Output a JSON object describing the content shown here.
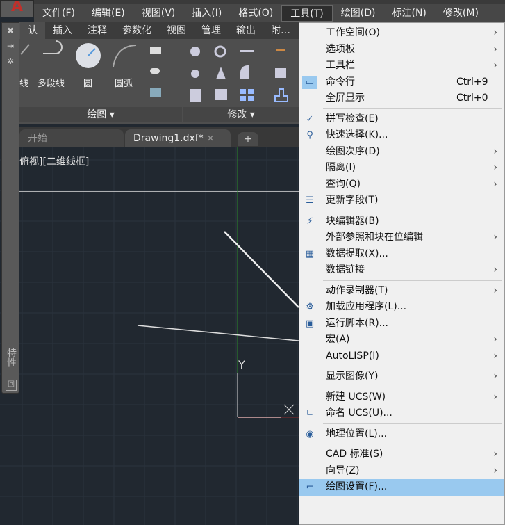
{
  "menubar": {
    "items": [
      "文件(F)",
      "编辑(E)",
      "视图(V)",
      "插入(I)",
      "格式(O)",
      "工具(T)",
      "绘图(D)",
      "标注(N)",
      "修改(M)"
    ],
    "active": "工具(T)"
  },
  "ribbon": {
    "tabs": [
      "默认",
      "插入",
      "注释",
      "参数化",
      "视图",
      "管理",
      "输出",
      "附加"
    ],
    "draw_tools": [
      "直线",
      "多段线",
      "圆",
      "圆弧"
    ],
    "draw_panel": "绘图",
    "modify_panel": "修改"
  },
  "doc_tabs": {
    "start": "开始",
    "drawing": "Drawing1.dxf*",
    "close": "×",
    "add": "+"
  },
  "viewport": {
    "label": "[-][俯视][二维线框]",
    "label_visible": "俯视][二维线框]",
    "ucs_y": "Y",
    "ucs_x": "X"
  },
  "palette": {
    "title": "特性"
  },
  "menu": {
    "items": [
      {
        "label": "工作空间(O)",
        "submenu": true
      },
      {
        "label": "选项板",
        "submenu": true
      },
      {
        "label": "工具栏",
        "submenu": true
      },
      {
        "label": "命令行",
        "shortcut": "Ctrl+9",
        "icon": "command-line-icon",
        "checked": true
      },
      {
        "label": "全屏显示",
        "shortcut": "Ctrl+0"
      },
      {
        "sep": true
      },
      {
        "label": "拼写检查(E)",
        "icon": "spell-check-icon"
      },
      {
        "label": "快速选择(K)...",
        "icon": "quick-select-icon"
      },
      {
        "label": "绘图次序(D)",
        "submenu": true
      },
      {
        "label": "隔离(I)",
        "submenu": true
      },
      {
        "label": "查询(Q)",
        "submenu": true
      },
      {
        "label": "更新字段(T)",
        "icon": "update-field-icon"
      },
      {
        "sep": true
      },
      {
        "label": "块编辑器(B)",
        "icon": "block-editor-icon"
      },
      {
        "label": "外部参照和块在位编辑",
        "submenu": true
      },
      {
        "label": "数据提取(X)...",
        "icon": "data-extraction-icon"
      },
      {
        "label": "数据链接",
        "submenu": true
      },
      {
        "sep": true
      },
      {
        "label": "动作录制器(T)",
        "submenu": true
      },
      {
        "label": "加载应用程序(L)...",
        "icon": "load-application-icon"
      },
      {
        "label": "运行脚本(R)...",
        "icon": "run-script-icon"
      },
      {
        "label": "宏(A)",
        "submenu": true
      },
      {
        "label": "AutoLISP(I)",
        "submenu": true
      },
      {
        "sep": true
      },
      {
        "label": "显示图像(Y)",
        "submenu": true
      },
      {
        "sep": true
      },
      {
        "label": "新建 UCS(W)",
        "submenu": true
      },
      {
        "label": "命名 UCS(U)...",
        "icon": "named-ucs-icon"
      },
      {
        "sep": true
      },
      {
        "label": "地理位置(L)...",
        "icon": "geolocation-icon"
      },
      {
        "sep": true
      },
      {
        "label": "CAD 标准(S)",
        "submenu": true
      },
      {
        "label": "向导(Z)",
        "submenu": true
      },
      {
        "label": "绘图设置(F)...",
        "icon": "drafting-settings-icon",
        "highlighted": true
      }
    ]
  },
  "colors": {
    "canvas": "#212830",
    "menu_highlight": "#99c9ef",
    "menu_bg": "#f0f0f0"
  }
}
